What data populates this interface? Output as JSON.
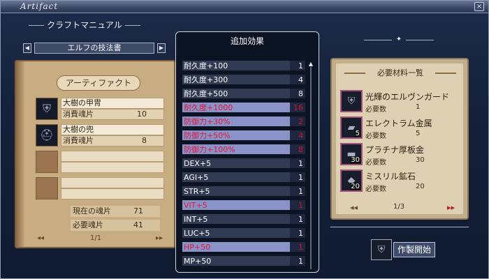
{
  "window": {
    "title": "Artifact",
    "close_label": "×"
  },
  "left": {
    "header": "クラフトマニュアル",
    "book_name": "エルフの技法書",
    "nav_prev": "◀",
    "nav_next": "▶",
    "book_title": "アーティファクト",
    "items": [
      {
        "name": "大樹の甲冑",
        "cost_label": "消費魂片",
        "cost": "10"
      },
      {
        "name": "大樹の兜",
        "cost_label": "消費魂片",
        "cost": "8"
      },
      {
        "name": "",
        "cost_label": "",
        "cost": ""
      },
      {
        "name": "",
        "cost_label": "",
        "cost": ""
      }
    ],
    "current_label": "現在の魂片",
    "current_value": "71",
    "required_label": "必要魂片",
    "required_value": "41",
    "pager": "1/1",
    "pager_prev": "◂◂",
    "pager_next": "▸▸"
  },
  "effects": {
    "title": "追加効果",
    "rows": [
      {
        "label": "耐久度+100",
        "value": "1",
        "highlight": false
      },
      {
        "label": "耐久度+300",
        "value": "4",
        "highlight": false
      },
      {
        "label": "耐久度+500",
        "value": "8",
        "highlight": false
      },
      {
        "label": "耐久度+1000",
        "value": "16",
        "highlight": true
      },
      {
        "label": "防御力+30%",
        "value": "2",
        "highlight": true
      },
      {
        "label": "防御力+50%",
        "value": "4",
        "highlight": true
      },
      {
        "label": "防御力+100%",
        "value": "8",
        "highlight": true
      },
      {
        "label": "DEX+5",
        "value": "1",
        "highlight": false
      },
      {
        "label": "AGI+5",
        "value": "1",
        "highlight": false
      },
      {
        "label": "STR+5",
        "value": "1",
        "highlight": false
      },
      {
        "label": "VIT+5",
        "value": "1",
        "highlight": true
      },
      {
        "label": "INT+5",
        "value": "1",
        "highlight": false
      },
      {
        "label": "LUC+5",
        "value": "1",
        "highlight": false
      },
      {
        "label": "HP+50",
        "value": "1",
        "highlight": true
      },
      {
        "label": "MP+50",
        "value": "1",
        "highlight": false
      }
    ]
  },
  "materials": {
    "title": "必要材料一覧",
    "req_label": "必要数",
    "items": [
      {
        "name": "光輝のエルヴンガード",
        "required": "1",
        "qty": ""
      },
      {
        "name": "エレクトラム金属",
        "required": "5",
        "qty": "5"
      },
      {
        "name": "プラチナ厚板金",
        "required": "30",
        "qty": "30"
      },
      {
        "name": "ミスリル鉱石",
        "required": "20",
        "qty": "20"
      }
    ],
    "pager": "1/3",
    "pager_prev": "◂◂",
    "pager_next": "▸▸"
  },
  "craft": {
    "button_label": "作製開始"
  },
  "colors": {
    "highlight_bg": "#8a93c8",
    "highlight_text": "#e0173c",
    "panel_bg": "#0c1322"
  }
}
